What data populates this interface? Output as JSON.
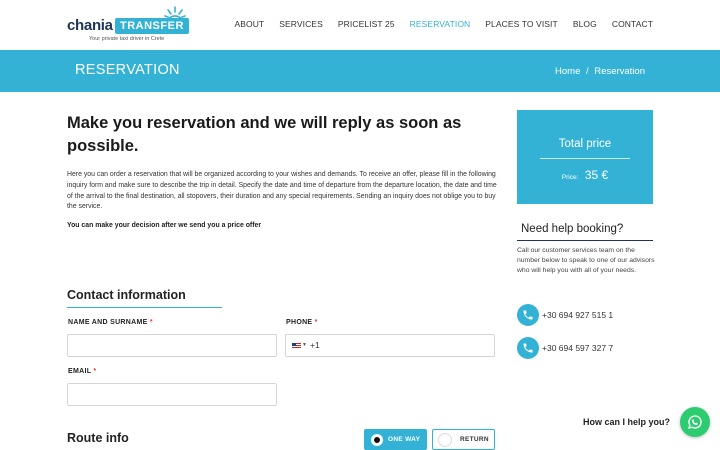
{
  "logo": {
    "word": "chania",
    "badge": "TRANSFER",
    "tagline": "Your private taxi driver in Crete"
  },
  "nav": [
    {
      "label": "ABOUT",
      "active": false
    },
    {
      "label": "SERVICES",
      "active": false
    },
    {
      "label": "PRICELIST 25",
      "active": false
    },
    {
      "label": "RESERVATION",
      "active": true
    },
    {
      "label": "PLACES TO VISIT",
      "active": false
    },
    {
      "label": "BLOG",
      "active": false
    },
    {
      "label": "CONTACT",
      "active": false
    }
  ],
  "banner": {
    "title": "RESERVATION",
    "breadcrumb_home": "Home",
    "breadcrumb_sep": "/",
    "breadcrumb_current": "Reservation"
  },
  "main": {
    "heading": "Make you reservation and we will reply as soon as possible.",
    "intro": "Here you can order a reservation that will be organized according to your wishes and demands. To receive an offer, please fill in the following inquiry form and make sure to describe the trip in detail. Specify the date and time of departure from the departure location, the date and time of the arrival to the final destination, all stopovers, their duration and any special requirements. Sending an inquiry does not oblige you to buy the service.",
    "decision": "You can make your decision after we send you a price offer"
  },
  "contact": {
    "title": "Contact information",
    "name_label": "NAME AND SURNAME",
    "phone_label": "PHONE",
    "email_label": "EMAIL",
    "required_mark": "*",
    "phone_code": "+1",
    "name_value": "",
    "email_value": ""
  },
  "route": {
    "title": "Route info",
    "one_way": "ONE WAY",
    "return": "RETURN",
    "selected": "one_way"
  },
  "price": {
    "title": "Total price",
    "label": "Price:",
    "value": "35 €"
  },
  "help": {
    "title": "Need help booking?",
    "text": "Call our customer services team on the number below to speak to one of our advisors who will help you with all of your needs.",
    "phones": [
      "+30 694 927 515 1",
      "+30 694 597 327 7"
    ]
  },
  "chat": {
    "text": "How can I help you?"
  },
  "colors": {
    "accent": "#33b2d6",
    "whatsapp": "#2ecc71",
    "required": "#e53935"
  }
}
